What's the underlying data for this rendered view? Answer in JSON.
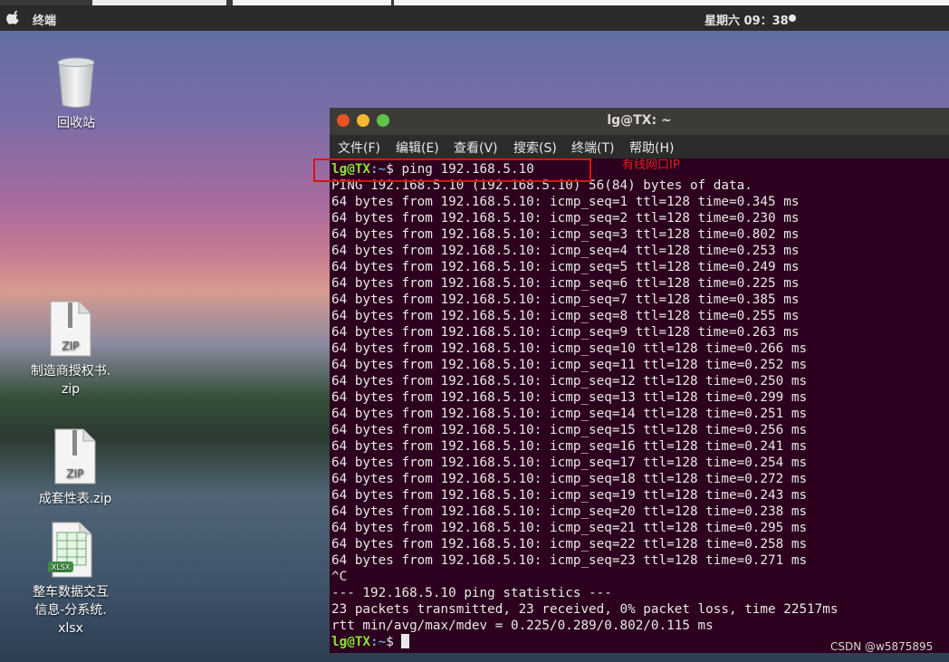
{
  "top_bar": {
    "app_name": "终端",
    "clock": "星期六 09：38"
  },
  "desktop": {
    "trash_label": "回收站",
    "files": [
      {
        "badge": "ZIP",
        "label_lines": [
          "制造商授权书.",
          "zip"
        ]
      },
      {
        "badge": "ZIP",
        "label_lines": [
          "成套性表.zip"
        ]
      },
      {
        "badge": "XLSX",
        "label_lines": [
          "整车数据交互",
          "信息-分系统.",
          "xlsx"
        ]
      }
    ]
  },
  "window": {
    "title": "lg@TX: ~",
    "menu": [
      "文件(F)",
      "编辑(E)",
      "查看(V)",
      "搜索(S)",
      "终端(T)",
      "帮助(H)"
    ]
  },
  "terminal": {
    "prompt_user": "lg@TX",
    "prompt_path": ":~",
    "prompt_symbol": "$ ",
    "command": "ping 192.168.5.10",
    "header": "PING 192.168.5.10 (192.168.5.10) 56(84) bytes of data.",
    "replies": [
      "64 bytes from 192.168.5.10: icmp_seq=1 ttl=128 time=0.345 ms",
      "64 bytes from 192.168.5.10: icmp_seq=2 ttl=128 time=0.230 ms",
      "64 bytes from 192.168.5.10: icmp_seq=3 ttl=128 time=0.802 ms",
      "64 bytes from 192.168.5.10: icmp_seq=4 ttl=128 time=0.253 ms",
      "64 bytes from 192.168.5.10: icmp_seq=5 ttl=128 time=0.249 ms",
      "64 bytes from 192.168.5.10: icmp_seq=6 ttl=128 time=0.225 ms",
      "64 bytes from 192.168.5.10: icmp_seq=7 ttl=128 time=0.385 ms",
      "64 bytes from 192.168.5.10: icmp_seq=8 ttl=128 time=0.255 ms",
      "64 bytes from 192.168.5.10: icmp_seq=9 ttl=128 time=0.263 ms",
      "64 bytes from 192.168.5.10: icmp_seq=10 ttl=128 time=0.266 ms",
      "64 bytes from 192.168.5.10: icmp_seq=11 ttl=128 time=0.252 ms",
      "64 bytes from 192.168.5.10: icmp_seq=12 ttl=128 time=0.250 ms",
      "64 bytes from 192.168.5.10: icmp_seq=13 ttl=128 time=0.299 ms",
      "64 bytes from 192.168.5.10: icmp_seq=14 ttl=128 time=0.251 ms",
      "64 bytes from 192.168.5.10: icmp_seq=15 ttl=128 time=0.256 ms",
      "64 bytes from 192.168.5.10: icmp_seq=16 ttl=128 time=0.241 ms",
      "64 bytes from 192.168.5.10: icmp_seq=17 ttl=128 time=0.254 ms",
      "64 bytes from 192.168.5.10: icmp_seq=18 ttl=128 time=0.272 ms",
      "64 bytes from 192.168.5.10: icmp_seq=19 ttl=128 time=0.243 ms",
      "64 bytes from 192.168.5.10: icmp_seq=20 ttl=128 time=0.238 ms",
      "64 bytes from 192.168.5.10: icmp_seq=21 ttl=128 time=0.295 ms",
      "64 bytes from 192.168.5.10: icmp_seq=22 ttl=128 time=0.258 ms",
      "64 bytes from 192.168.5.10: icmp_seq=23 ttl=128 time=0.271 ms"
    ],
    "interrupt": "^C",
    "stats_header": "--- 192.168.5.10 ping statistics ---",
    "stats_packets": "23 packets transmitted, 23 received, 0% packet loss, time 22517ms",
    "stats_rtt": "rtt min/avg/max/mdev = 0.225/0.289/0.802/0.115 ms"
  },
  "annotation": {
    "text": "有线网口IP",
    "color": "#e01010"
  },
  "watermark": "CSDN @w5875895",
  "colors": {
    "terminal_bg": "#2c001e",
    "prompt_user": "#8ae234",
    "prompt_path": "#729fcf",
    "close": "#e95420",
    "minimize": "#f5b82e",
    "maximize": "#5ec448"
  }
}
